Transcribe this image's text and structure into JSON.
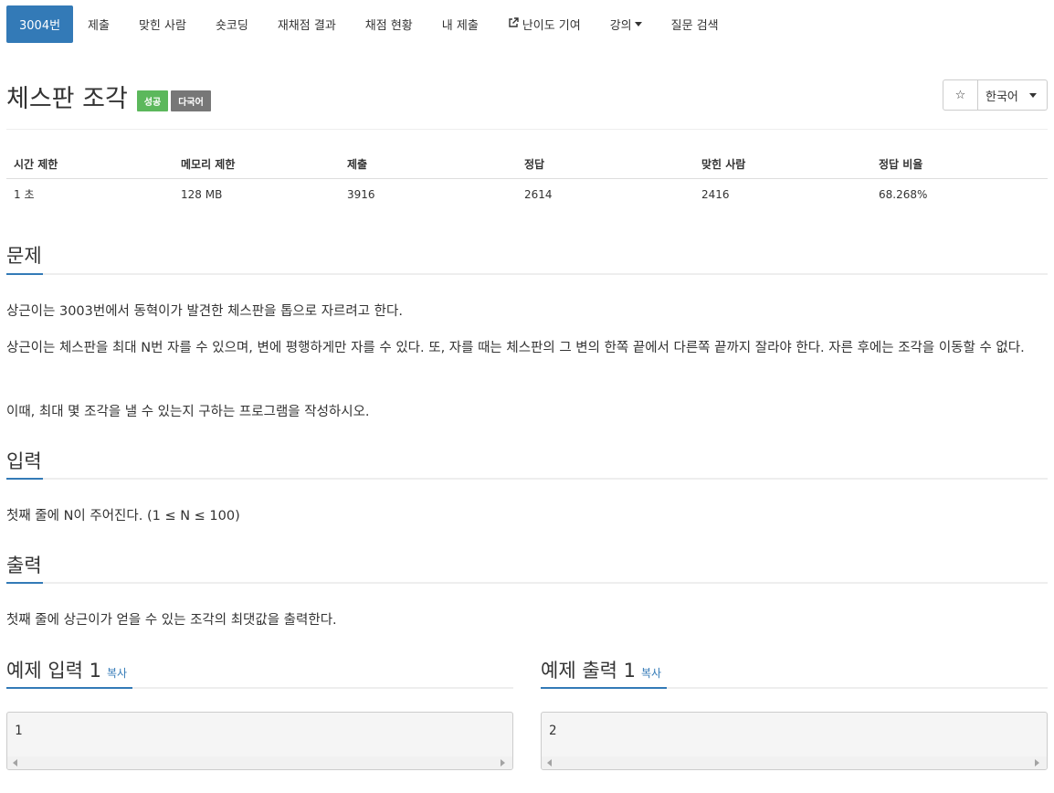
{
  "nav": {
    "items": [
      {
        "label": "3004번"
      },
      {
        "label": "제출"
      },
      {
        "label": "맞힌 사람"
      },
      {
        "label": "숏코딩"
      },
      {
        "label": "재채점 결과"
      },
      {
        "label": "채점 현황"
      },
      {
        "label": "내 제출"
      },
      {
        "label": "난이도 기여",
        "icon": "external-link-icon"
      },
      {
        "label": "강의",
        "icon": "caret-down-icon"
      },
      {
        "label": "질문 검색"
      }
    ]
  },
  "problem": {
    "title": "체스판 조각",
    "badges": {
      "success": "성공",
      "multilang": "다국어"
    },
    "colors": {
      "success": "#5cb85c",
      "multilang": "#777777",
      "accent": "#337ab7"
    }
  },
  "toolbar": {
    "star": "☆",
    "language": "한국어"
  },
  "info": {
    "headers": [
      "시간 제한",
      "메모리 제한",
      "제출",
      "정답",
      "맞힌 사람",
      "정답 비율"
    ],
    "values": [
      "1 초",
      "128 MB",
      "3916",
      "2614",
      "2416",
      "68.268%"
    ]
  },
  "sections": {
    "problem": {
      "heading": "문제",
      "paragraphs": [
        "상근이는 3003번에서 동혁이가 발견한 체스판을 톱으로 자르려고 한다.",
        "상근이는 체스판을 최대 N번 자를 수 있으며, 변에 평행하게만 자를 수 있다. 또, 자를 때는 체스판의 그 변의 한쪽 끝에서 다른쪽 끝까지 잘라야 한다. 자른 후에는 조각을 이동할 수 없다.",
        "이때, 최대 몇 조각을 낼 수 있는지 구하는 프로그램을 작성하시오."
      ]
    },
    "input": {
      "heading": "입력",
      "text": "첫째 줄에 N이 주어진다. (1 ≤ N ≤ 100)"
    },
    "output": {
      "heading": "출력",
      "text": "첫째 줄에 상근이가 얻을 수 있는 조각의 최댓값을 출력한다."
    }
  },
  "examples": {
    "input": {
      "heading": "예제 입력 1",
      "copy": "복사",
      "content": "1"
    },
    "output": {
      "heading": "예제 출력 1",
      "copy": "복사",
      "content": "2"
    }
  }
}
